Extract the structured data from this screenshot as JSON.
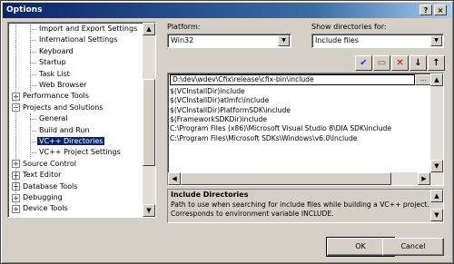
{
  "window": {
    "title": "Options"
  },
  "title_buttons": {
    "help": "?",
    "close": "×"
  },
  "tree": {
    "items": [
      {
        "label": "Import and Export Settings",
        "level": 2,
        "expander": ""
      },
      {
        "label": "International Settings",
        "level": 2,
        "expander": ""
      },
      {
        "label": "Keyboard",
        "level": 2,
        "expander": ""
      },
      {
        "label": "Startup",
        "level": 2,
        "expander": ""
      },
      {
        "label": "Task List",
        "level": 2,
        "expander": ""
      },
      {
        "label": "Web Browser",
        "level": 2,
        "expander": ""
      },
      {
        "label": "Performance Tools",
        "level": 1,
        "expander": "+"
      },
      {
        "label": "Projects and Solutions",
        "level": 1,
        "expander": "−"
      },
      {
        "label": "General",
        "level": 2,
        "expander": ""
      },
      {
        "label": "Build and Run",
        "level": 2,
        "expander": ""
      },
      {
        "label": "VC++ Directories",
        "level": 2,
        "expander": "",
        "selected": true
      },
      {
        "label": "VC++ Project Settings",
        "level": 2,
        "expander": ""
      },
      {
        "label": "Source Control",
        "level": 1,
        "expander": "+"
      },
      {
        "label": "Text Editor",
        "level": 1,
        "expander": "+"
      },
      {
        "label": "Database Tools",
        "level": 1,
        "expander": "+"
      },
      {
        "label": "Debugging",
        "level": 1,
        "expander": "+"
      },
      {
        "label": "Device Tools",
        "level": 1,
        "expander": "+"
      }
    ]
  },
  "platform": {
    "label": "Platform:",
    "value": "Win32"
  },
  "show_dirs": {
    "label": "Show directories for:",
    "value": "Include files"
  },
  "toolbar": {
    "check": "✔",
    "new_folder": "▭",
    "delete": "✕",
    "down": "↓",
    "up": "↑"
  },
  "directories": {
    "editing": "D:\\dev\\wdev\\Cfix\\release\\cfix-bin\\include",
    "ellipsis": "...",
    "items": [
      "$(VCInstallDir)include",
      "$(VCInstallDir)atlmfc\\include",
      "$(VCInstallDir)PlatformSDK\\include",
      "$(FrameworkSDKDir)include",
      "C:\\Program Files (x86)\\Microsoft Visual Studio 8\\DIA SDK\\include",
      "C:\\Program Files\\Microsoft SDKs\\Windows\\v6.0\\Include"
    ]
  },
  "description": {
    "title": "Include Directories",
    "line1": "Path to use when searching for include files while building a VC++ project.",
    "line2": "Corresponds to environment variable INCLUDE."
  },
  "buttons": {
    "ok": "OK",
    "cancel": "Cancel"
  },
  "colors": {
    "title_start": "#0a246a",
    "title_end": "#a6caf0",
    "selection": "#0a246a",
    "face": "#d4d0c8"
  }
}
